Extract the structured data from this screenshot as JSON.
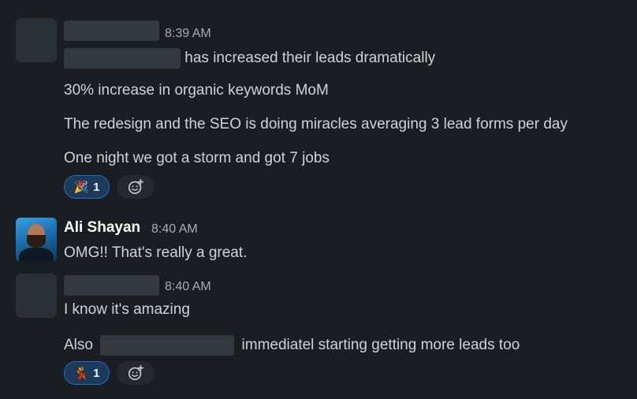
{
  "messages": [
    {
      "time": "8:39 AM",
      "lines": {
        "l1_suffix": "has increased their leads dramatically",
        "l2": "30% increase in organic keywords MoM",
        "l3": "The redesign and the SEO is doing miracles averaging 3 lead forms per day",
        "l4": "One night we got a storm and got 7 jobs"
      },
      "reaction": {
        "emoji": "🎉",
        "count": "1"
      }
    },
    {
      "sender": "Ali Shayan",
      "time": "8:40 AM",
      "text": "OMG!! That's really a great."
    },
    {
      "time": "8:40 AM",
      "lines": {
        "l1": "I know it's amazing",
        "l2_prefix": "Also",
        "l2_suffix": "immediatel starting getting more leads too"
      },
      "reaction": {
        "emoji": "💃",
        "count": "1"
      }
    }
  ],
  "colors": {
    "background": "#1a1d21",
    "reaction_bg": "#1d3a5a",
    "reaction_border": "#1f6fc7"
  },
  "icons": {
    "add_reaction": "add-emoji-icon"
  }
}
